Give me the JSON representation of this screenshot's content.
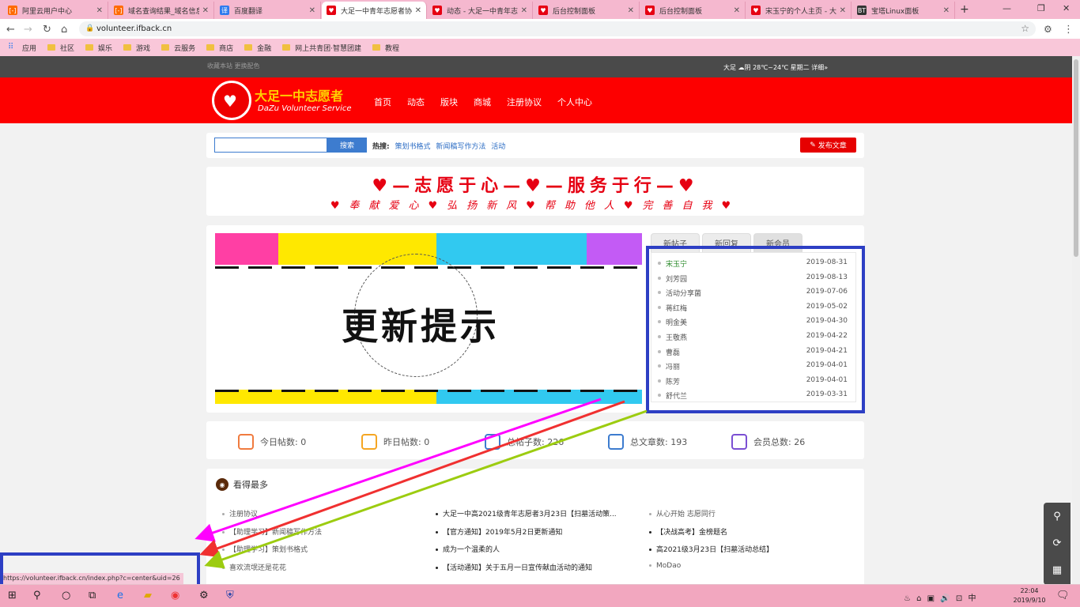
{
  "browser": {
    "tabs": [
      {
        "title": "阿里云用户中心",
        "icon": "aliyun-icon",
        "color": "#ff6a00",
        "glyph": "[-]"
      },
      {
        "title": "域名查询结果_域名信息",
        "icon": "aliyun-icon",
        "color": "#ff6a00",
        "glyph": "[-]"
      },
      {
        "title": "百度翻译",
        "icon": "translate-icon",
        "color": "#2f7bee",
        "glyph": "译"
      },
      {
        "title": "大足一中青年志愿者协会",
        "icon": "heart-icon",
        "color": "#e60012",
        "glyph": "♥"
      },
      {
        "title": "动态 - 大足一中青年志愿者",
        "icon": "heart-icon",
        "color": "#e60012",
        "glyph": "♥"
      },
      {
        "title": "后台控制面板",
        "icon": "heart-icon",
        "color": "#e60012",
        "glyph": "♥"
      },
      {
        "title": "后台控制面板",
        "icon": "heart-icon",
        "color": "#e60012",
        "glyph": "♥"
      },
      {
        "title": "宋玉宁的个人主页 - 大足",
        "icon": "heart-icon",
        "color": "#e60012",
        "glyph": "♥"
      },
      {
        "title": "宝塔Linux面板",
        "icon": "bt-icon",
        "color": "#333333",
        "glyph": "BT"
      }
    ],
    "url": "volunteer.ifback.cn",
    "bookmarks": [
      "应用",
      "社区",
      "娱乐",
      "游戏",
      "云服务",
      "商店",
      "金融",
      "网上共青团·智慧团建",
      "教程"
    ]
  },
  "site": {
    "topbar_left": "收藏本站 更换配色",
    "topbar_right": "大足 ☁阴 28℃~24℃ 星期二 详细»",
    "logo_title": "大足一中志愿者",
    "logo_sub": "DaZu Volunteer Service",
    "nav": [
      "首页",
      "动态",
      "版块",
      "商城",
      "注册协议",
      "个人中心"
    ],
    "search_button": "搜索",
    "hot_label": "热搜:",
    "hot_links": [
      "策划书格式",
      "新闻稿写作方法",
      "活动"
    ],
    "post_button": "发布文章",
    "slogan1": "♥—志愿于心—♥—服务于行—♥",
    "slogan2": "♥奉献爱心♥弘扬新风♥帮助他人♥完善自我♥",
    "slide_text": "更新提示",
    "side_tabs": [
      "新帖子",
      "新回复",
      "新会员"
    ],
    "members": [
      {
        "name": "宋玉宁",
        "date": "2019-08-31"
      },
      {
        "name": "刘芳园",
        "date": "2019-08-13"
      },
      {
        "name": "活动分享菌",
        "date": "2019-07-06"
      },
      {
        "name": "蒋红梅",
        "date": "2019-05-02"
      },
      {
        "name": "明金美",
        "date": "2019-04-30"
      },
      {
        "name": "王敬燕",
        "date": "2019-04-22"
      },
      {
        "name": "曹磊",
        "date": "2019-04-21"
      },
      {
        "name": "冯丽",
        "date": "2019-04-01"
      },
      {
        "name": "陈芳",
        "date": "2019-04-01"
      },
      {
        "name": "舒代兰",
        "date": "2019-03-31"
      }
    ],
    "stats": [
      {
        "label": "今日帖数: 0",
        "color": "#f07b3f"
      },
      {
        "label": "昨日帖数: 0",
        "color": "#f5a623"
      },
      {
        "label": "总帖子数: 226",
        "color": "#3d7ccf"
      },
      {
        "label": "总文章数: 193",
        "color": "#3d7ccf"
      },
      {
        "label": "会员总数: 26",
        "color": "#7b4fd3"
      }
    ],
    "most_viewed_title": "看得最多",
    "col1": [
      "注册协议",
      "【助理学习】新闻稿写作方法",
      "【助理学习】策划书格式",
      "喜欢流氓还是花花"
    ],
    "col2": [
      "大足一中高2021级青年志愿者3月23日【扫墓活动策...",
      "【官方通知】2019年5月2日更新通知",
      "成为一个温柔的人",
      "【活动通知】关于五月一日宣传献血活动的通知"
    ],
    "col3": [
      "从心开始 志愿同行",
      "【决战高考】金榜题名",
      "高2021级3月23日【扫墓活动总结】",
      "MoDao"
    ]
  },
  "status_url": "https://volunteer.ifback.cn/index.php?c=center&uid=26",
  "clock": {
    "time": "22:04",
    "date": "2019/9/10"
  },
  "tray": "♨ ⌂ ▣ 🔊 ⊡ 中",
  "accent": "#fd0000",
  "highlight": "#2d3fc4"
}
